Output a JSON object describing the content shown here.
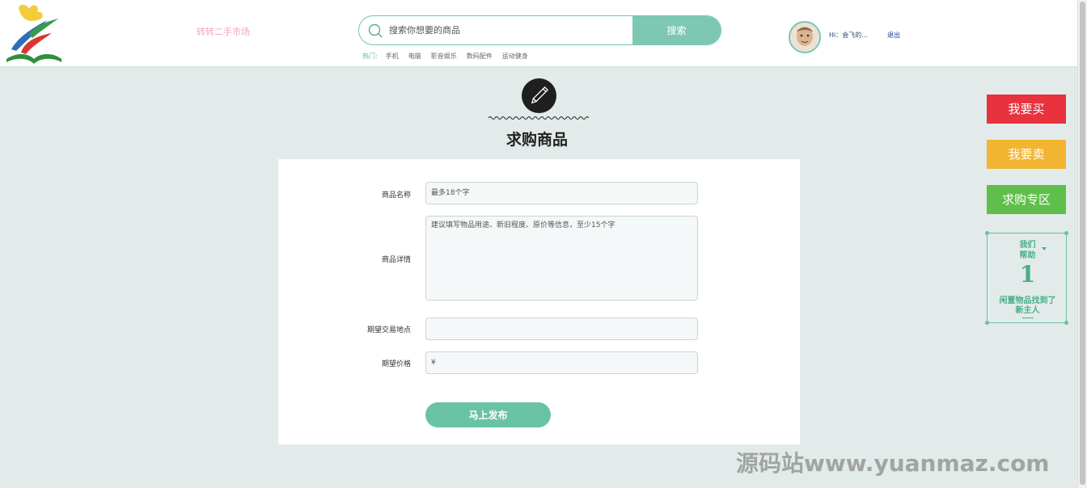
{
  "header": {
    "site_name": "转转二手市场",
    "search": {
      "placeholder": "搜索你想要的商品",
      "button_label": "搜索"
    },
    "hot": {
      "label": "热门:",
      "items": [
        "手机",
        "电脑",
        "影音娱乐",
        "数码配件",
        "运动健身"
      ]
    },
    "user": {
      "greeting": "Hi：会飞的...",
      "logout_label": "退出"
    }
  },
  "page": {
    "title": "求购商品"
  },
  "form": {
    "name": {
      "label": "商品名称",
      "placeholder": "最多18个字"
    },
    "detail": {
      "label": "商品详情",
      "placeholder": "建议填写物品用途、新旧程度、原价等信息，至少15个字"
    },
    "location": {
      "label": "期望交易地点",
      "placeholder": ""
    },
    "price": {
      "label": "期望价格",
      "placeholder": "¥"
    },
    "submit_label": "马上发布"
  },
  "sidebar": {
    "buy_label": "我要买",
    "sell_label": "我要卖",
    "want_label": "求购专区",
    "help": {
      "top_line1": "我们",
      "top_line2": "帮助",
      "count": "1",
      "bottom": "闲置物品找到了新主人"
    }
  },
  "watermark": "源码站www.yuanmaz.com",
  "colors": {
    "accent": "#69c2a5",
    "buy": "#e8323e",
    "sell": "#f2b531",
    "want": "#5fbf4a",
    "background": "#e2ebea"
  }
}
